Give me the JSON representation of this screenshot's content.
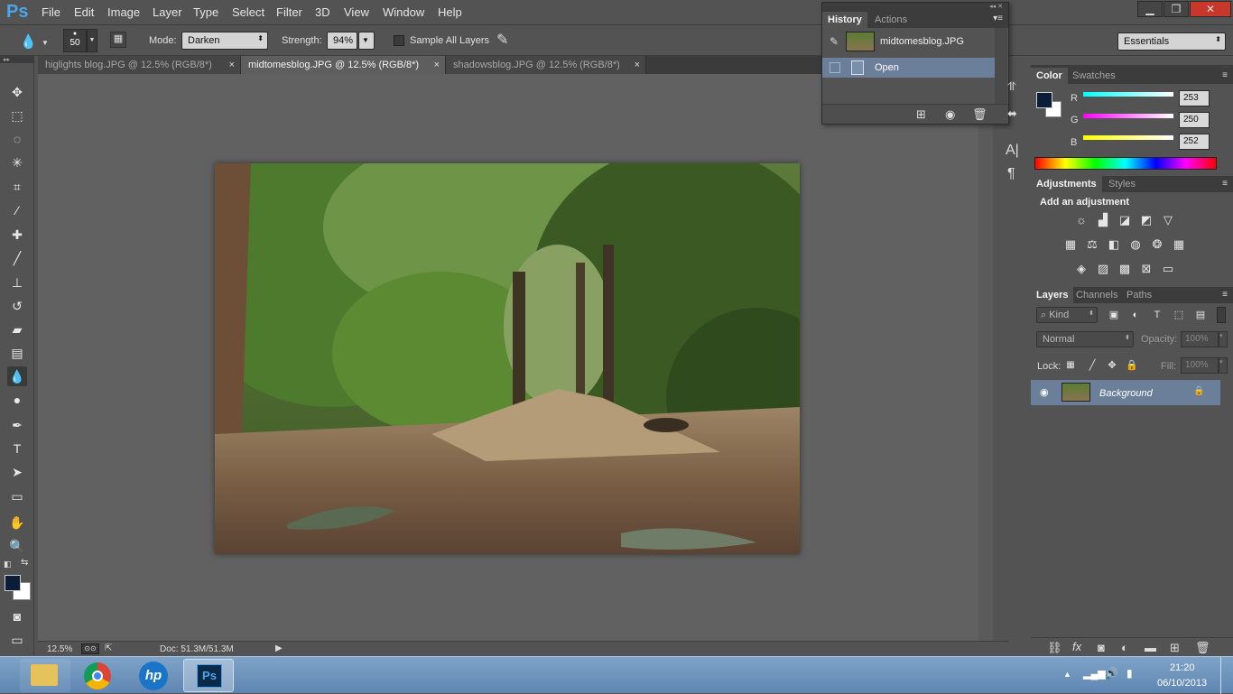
{
  "app": {
    "logo": "Ps"
  },
  "menu": [
    "File",
    "Edit",
    "Image",
    "Layer",
    "Type",
    "Select",
    "Filter",
    "3D",
    "View",
    "Window",
    "Help"
  ],
  "window_controls": {
    "minimize": "▁",
    "restore": "❐",
    "close": "✕"
  },
  "options": {
    "brush_size": "50",
    "mode_label": "Mode:",
    "mode_value": "Darken",
    "strength_label": "Strength:",
    "strength_value": "94%",
    "sample_all_layers": "Sample All Layers",
    "workspace": "Essentials"
  },
  "tabs": [
    {
      "label": "higlights blog.JPG @ 12.5% (RGB/8*)",
      "close": "×"
    },
    {
      "label": "midtomesblog.JPG @ 12.5% (RGB/8*)",
      "close": "×"
    },
    {
      "label": "shadowsblog.JPG @ 12.5% (RGB/8*)",
      "close": "×"
    }
  ],
  "status": {
    "zoom": "12.5%",
    "doc": "Doc: 51.3M/51.3M"
  },
  "history": {
    "tabs": [
      "History",
      "Actions"
    ],
    "snapshot_label": "midtomesblog.JPG",
    "item_open": "Open"
  },
  "color": {
    "tabs": [
      "Color",
      "Swatches"
    ],
    "r_label": "R",
    "g_label": "G",
    "b_label": "B",
    "r_value": "253",
    "g_value": "250",
    "b_value": "252"
  },
  "adjustments": {
    "tabs": [
      "Adjustments",
      "Styles"
    ],
    "heading": "Add an adjustment"
  },
  "layers": {
    "tabs": [
      "Layers",
      "Channels",
      "Paths"
    ],
    "filter_kind": "Kind",
    "blend_mode": "Normal",
    "opacity_label": "Opacity:",
    "opacity_value": "100%",
    "lock_label": "Lock:",
    "fill_label": "Fill:",
    "fill_value": "100%",
    "layer_name": "Background"
  },
  "taskbar": {
    "time": "21:20",
    "date": "06/10/2013"
  },
  "colors": {
    "accent_ps": "#4aa6e8",
    "foreground_swatch": "#0c1d3a",
    "background_swatch": "#ffffff",
    "selected_row": "#6b7f9a"
  }
}
